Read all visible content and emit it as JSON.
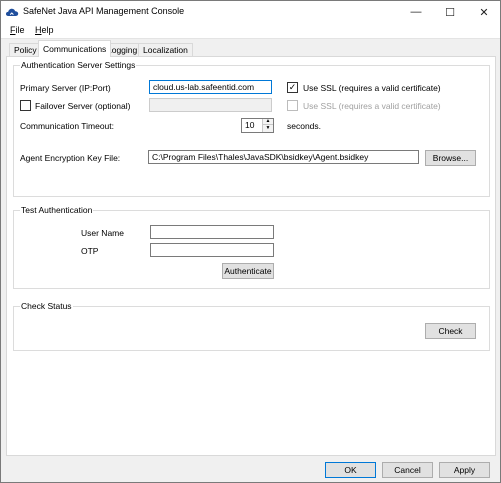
{
  "window": {
    "title": "SafeNet Java API Management Console",
    "minimize_glyph": "—",
    "maximize_glyph": "☐",
    "close_glyph": "✕",
    "icon": "cloud-icon"
  },
  "menu": {
    "file": {
      "accel": "F",
      "rest": "ile"
    },
    "help": {
      "accel": "H",
      "rest": "elp"
    }
  },
  "tabs": [
    "Policy",
    "Communications",
    "Logging",
    "Localization"
  ],
  "auth_server": {
    "group_title": "Authentication Server Settings",
    "primary_label": "Primary Server (IP:Port)",
    "primary_value": "cloud.us-lab.safeentid.com",
    "failover_label": "Failover Server (optional)",
    "failover_value": "",
    "use_ssl_label": "Use SSL (requires a valid certificate)",
    "use_ssl_checked": true,
    "failover_ssl_label": "Use SSL (requires a valid certificate)",
    "failover_ssl_checked": false,
    "failover_checked": false,
    "timeout_label": "Communication Timeout:",
    "timeout_value": "10",
    "timeout_unit": "seconds.",
    "key_file_label": "Agent Encryption Key File:",
    "key_file_value": "C:\\Program Files\\Thales\\JavaSDK\\bsidkey\\Agent.bsidkey",
    "browse_label": "Browse..."
  },
  "test_auth": {
    "group_title": "Test Authentication",
    "username_label": "User Name",
    "username_value": "",
    "otp_label": "OTP",
    "otp_value": "",
    "authenticate_label": "Authenticate"
  },
  "check_status": {
    "group_title": "Check Status",
    "check_label": "Check"
  },
  "footer": {
    "ok_label": "OK",
    "cancel_label": "Cancel",
    "apply_label": "Apply"
  },
  "colors": {
    "accent": "#0078d7",
    "icon_cloud": "#1f4e9c"
  }
}
